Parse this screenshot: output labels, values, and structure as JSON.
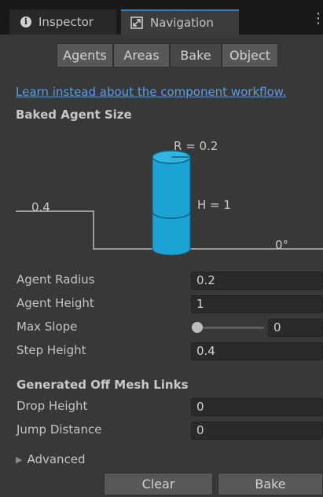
{
  "tabs": [
    {
      "label": "Inspector",
      "icon": "info-icon"
    },
    {
      "label": "Navigation",
      "icon": "navigation-icon"
    }
  ],
  "window_menu_icon": "vertical-dots-icon",
  "toolbar": [
    "Agents",
    "Areas",
    "Bake",
    "Object"
  ],
  "active_toolbar_tab": "Bake",
  "learn_link": "Learn instead about the component workflow.",
  "baked_agent_size": {
    "title": "Baked Agent Size",
    "radius_label": "R = 0.2",
    "height_label": "H = 1",
    "step_label": "0.4",
    "slope_label": "0°"
  },
  "fields": {
    "agent_radius": {
      "label": "Agent Radius",
      "value": "0.2"
    },
    "agent_height": {
      "label": "Agent Height",
      "value": "1"
    },
    "max_slope": {
      "label": "Max Slope",
      "value": "0",
      "slider_fraction": 0
    },
    "step_height": {
      "label": "Step Height",
      "value": "0.4"
    }
  },
  "off_mesh": {
    "title": "Generated Off Mesh Links",
    "drop_height": {
      "label": "Drop Height",
      "value": "0"
    },
    "jump_distance": {
      "label": "Jump Distance",
      "value": "0"
    }
  },
  "advanced": {
    "label": "Advanced",
    "expanded": false
  },
  "buttons": {
    "clear": "Clear",
    "bake": "Bake"
  },
  "colors": {
    "link": "#5a9ce6",
    "cylinder": "#1ba3d4",
    "active_tab_accent": "#3a79bb"
  }
}
